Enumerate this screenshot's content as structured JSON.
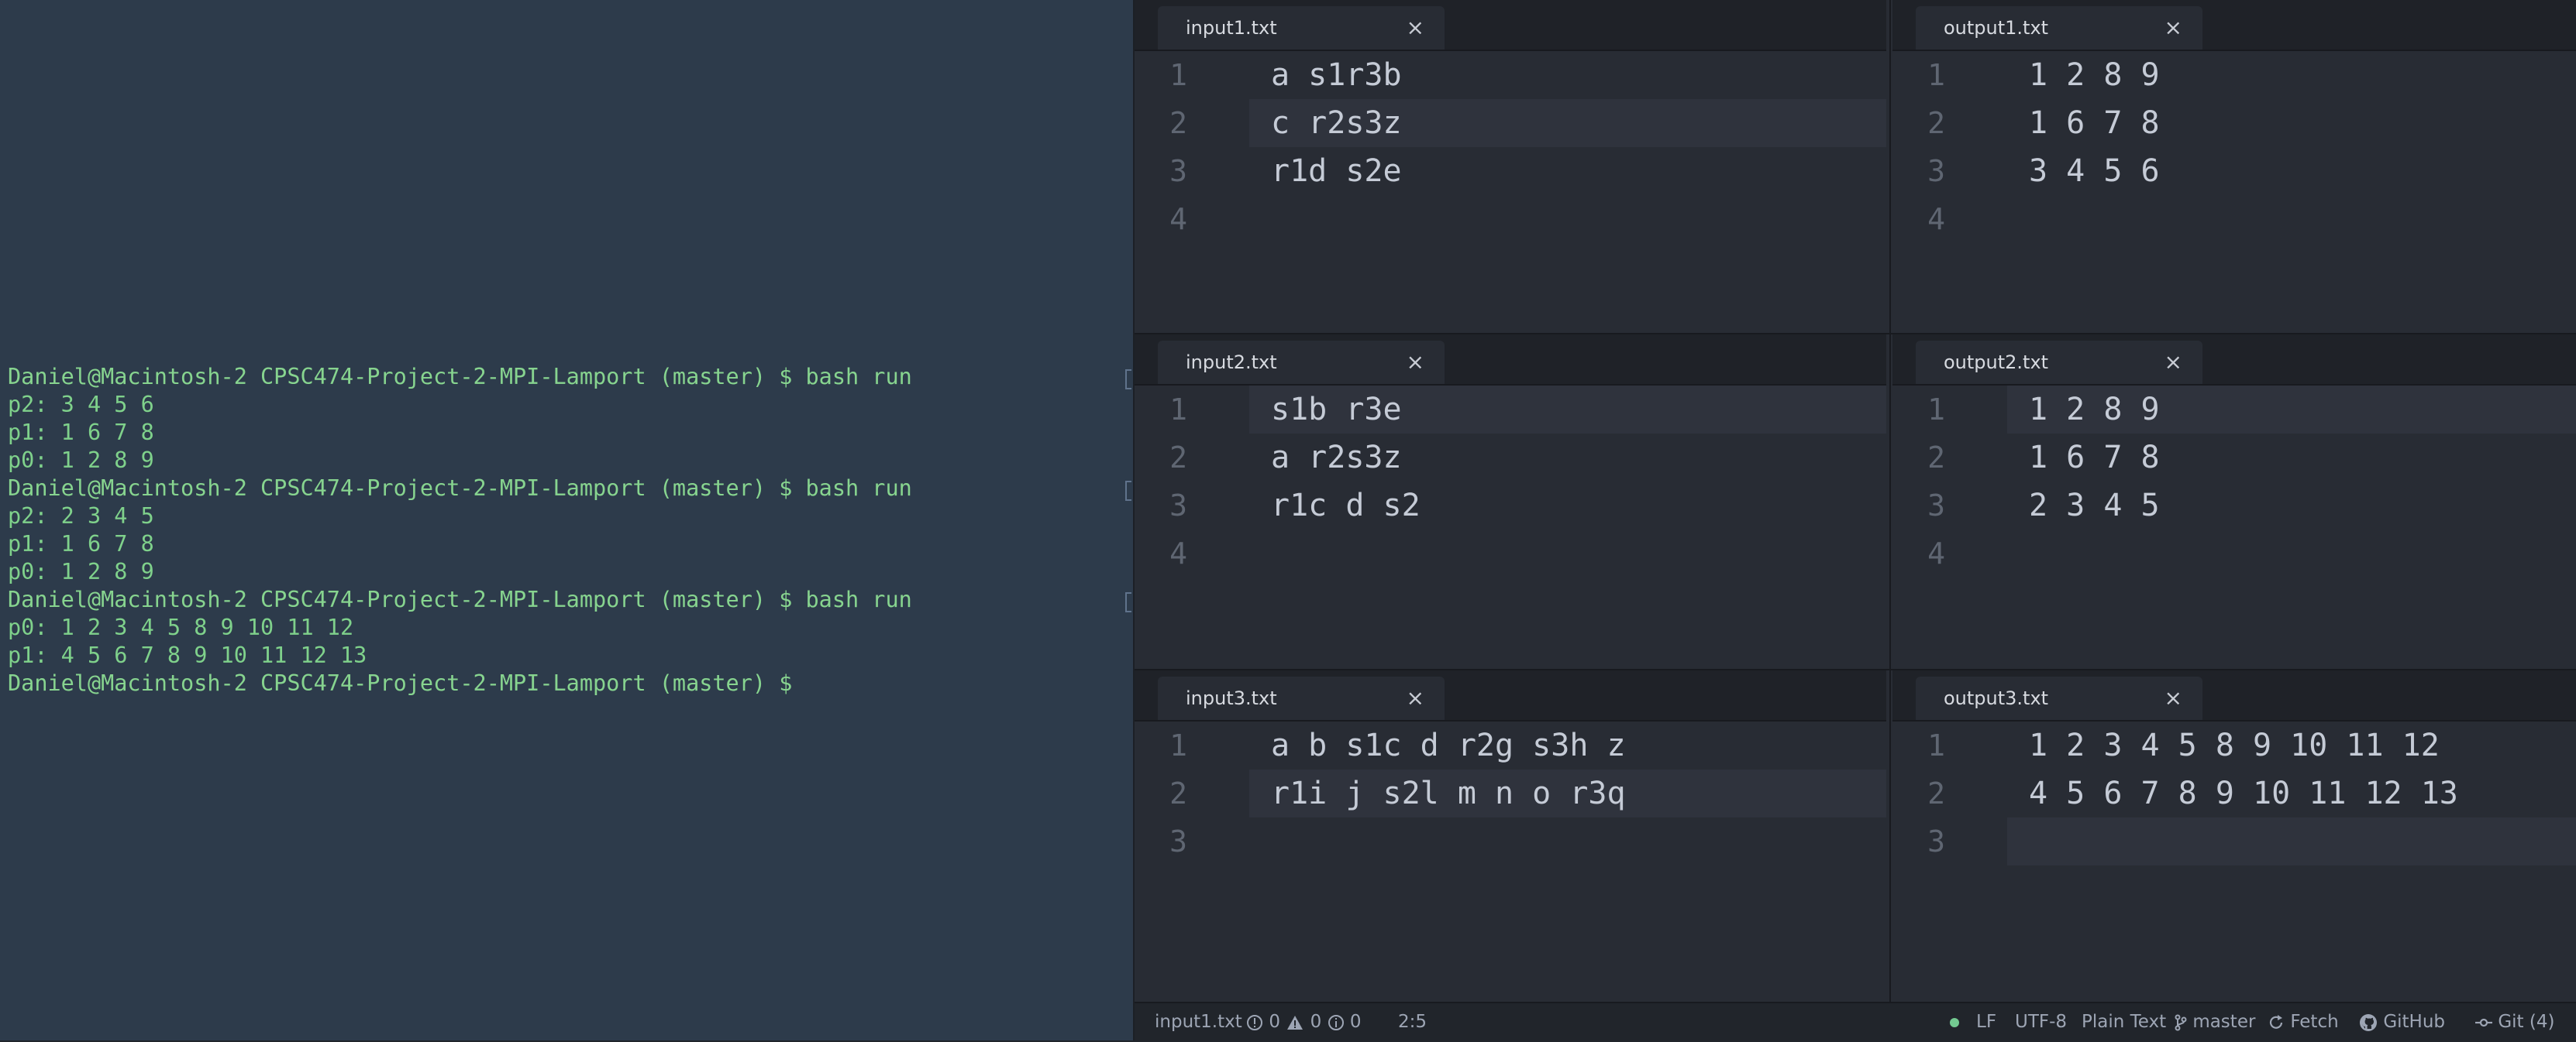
{
  "terminal": {
    "lines": [
      "Daniel@Macintosh-2 CPSC474-Project-2-MPI-Lamport (master) $ bash run",
      "p2: 3 4 5 6",
      "p1: 1 6 7 8",
      "p0: 1 2 8 9",
      "Daniel@Macintosh-2 CPSC474-Project-2-MPI-Lamport (master) $ bash run",
      "p2: 2 3 4 5",
      "p1: 1 6 7 8",
      "p0: 1 2 8 9",
      "Daniel@Macintosh-2 CPSC474-Project-2-MPI-Lamport (master) $ bash run",
      "p0: 1 2 3 4 5 8 9 10 11 12",
      "p1: 4 5 6 7 8 9 10 11 12 13",
      "Daniel@Macintosh-2 CPSC474-Project-2-MPI-Lamport (master) $ "
    ]
  },
  "panes": [
    {
      "tab": "input1.txt",
      "close": "×",
      "lines": [
        "a s1r3b",
        "c r2s3z",
        "r1d s2e",
        ""
      ],
      "numbers": [
        "1",
        "2",
        "3",
        "4"
      ]
    },
    {
      "tab": "output1.txt",
      "close": "×",
      "lines": [
        "1 2 8 9",
        "1 6 7 8",
        "3 4 5 6",
        ""
      ],
      "numbers": [
        "1",
        "2",
        "3",
        "4"
      ]
    },
    {
      "tab": "input2.txt",
      "close": "×",
      "lines": [
        "s1b r3e",
        "a r2s3z",
        "r1c d s2",
        ""
      ],
      "numbers": [
        "1",
        "2",
        "3",
        "4"
      ]
    },
    {
      "tab": "output2.txt",
      "close": "×",
      "lines": [
        "1 2 8 9",
        "1 6 7 8",
        "2 3 4 5",
        ""
      ],
      "numbers": [
        "1",
        "2",
        "3",
        "4"
      ]
    },
    {
      "tab": "input3.txt",
      "close": "×",
      "lines": [
        "a b s1c d r2g s3h z",
        "r1i j s2l m n o r3q",
        ""
      ],
      "numbers": [
        "1",
        "2",
        "3"
      ]
    },
    {
      "tab": "output3.txt",
      "close": "×",
      "lines": [
        "1 2 3 4 5 8 9 10 11 12",
        "4 5 6 7 8 9 10 11 12 13",
        ""
      ],
      "numbers": [
        "1",
        "2",
        "3"
      ]
    }
  ],
  "statusbar": {
    "file": "input1.txt",
    "errors": "0",
    "warnings": "0",
    "infos": "0",
    "cursor": "2:5",
    "line_ending": "LF",
    "encoding": "UTF-8",
    "grammar": "Plain Text",
    "branch": "master",
    "fetch": "Fetch",
    "github": "GitHub",
    "git": "Git (4)"
  },
  "colors": {
    "terminal_bg": "#2d3b4b",
    "terminal_text": "#7fd18b",
    "editor_bg": "#282c34"
  }
}
